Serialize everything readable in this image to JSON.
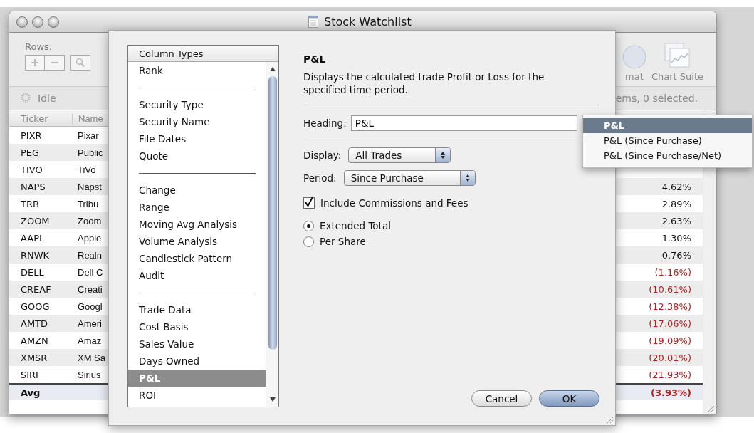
{
  "window": {
    "title": "Stock Watchlist"
  },
  "toolbar": {
    "rows_label": "Rows:",
    "items": [
      {
        "label": "mat"
      },
      {
        "label": "Chart Suite"
      }
    ]
  },
  "status_bar": {
    "state": "Idle",
    "summary": "ems, 0 selected."
  },
  "table": {
    "columns": [
      "Ticker",
      "Name"
    ],
    "rows": [
      {
        "ticker": "PIXR",
        "name": "Pixar"
      },
      {
        "ticker": "PEG",
        "name": "Public"
      },
      {
        "ticker": "TIVO",
        "name": "TiVo"
      },
      {
        "ticker": "NAPS",
        "name": "Napst",
        "value": "4.62%",
        "negative": false
      },
      {
        "ticker": "TRB",
        "name": "Tribu",
        "value": "2.89%",
        "negative": false
      },
      {
        "ticker": "ZOOM",
        "name": "Zoom",
        "value": "2.63%",
        "negative": false
      },
      {
        "ticker": "AAPL",
        "name": "Apple",
        "value": "1.30%",
        "negative": false
      },
      {
        "ticker": "RNWK",
        "name": "Realn",
        "value": "0.76%",
        "negative": false
      },
      {
        "ticker": "DELL",
        "name": "Dell C",
        "value": "(1.16%)",
        "negative": true
      },
      {
        "ticker": "CREAF",
        "name": "Creati",
        "value": "(10.61%)",
        "negative": true
      },
      {
        "ticker": "GOOG",
        "name": "Googl",
        "value": "(12.38%)",
        "negative": true
      },
      {
        "ticker": "AMTD",
        "name": "Ameri",
        "value": "(17.06%)",
        "negative": true
      },
      {
        "ticker": "AMZN",
        "name": "Amaz",
        "value": "(19.09%)",
        "negative": true
      },
      {
        "ticker": "XMSR",
        "name": "XM Sa",
        "value": "(20.01%)",
        "negative": true
      },
      {
        "ticker": "SIRI",
        "name": "Sirius",
        "value": "(21.93%)",
        "negative": true
      }
    ],
    "total": {
      "ticker": "Avg",
      "value": "(3.93%)",
      "negative": true
    }
  },
  "sheet": {
    "list": {
      "header": "Column Types",
      "items": [
        {
          "kind": "item",
          "label": "Rank",
          "selected": false
        },
        {
          "kind": "separator"
        },
        {
          "kind": "item",
          "label": "Security Type",
          "selected": false
        },
        {
          "kind": "item",
          "label": "Security Name",
          "selected": false
        },
        {
          "kind": "item",
          "label": "File Dates",
          "selected": false
        },
        {
          "kind": "item",
          "label": "Quote",
          "selected": false
        },
        {
          "kind": "separator"
        },
        {
          "kind": "item",
          "label": "Change",
          "selected": false
        },
        {
          "kind": "item",
          "label": "Range",
          "selected": false
        },
        {
          "kind": "item",
          "label": "Moving Avg Analysis",
          "selected": false
        },
        {
          "kind": "item",
          "label": "Volume Analysis",
          "selected": false
        },
        {
          "kind": "item",
          "label": "Candlestick Pattern",
          "selected": false
        },
        {
          "kind": "item",
          "label": "Audit",
          "selected": false
        },
        {
          "kind": "separator"
        },
        {
          "kind": "item",
          "label": "Trade Data",
          "selected": false
        },
        {
          "kind": "item",
          "label": "Cost Basis",
          "selected": false
        },
        {
          "kind": "item",
          "label": "Sales Value",
          "selected": false
        },
        {
          "kind": "item",
          "label": "Days Owned",
          "selected": false
        },
        {
          "kind": "item",
          "label": "P&L",
          "selected": true
        },
        {
          "kind": "item",
          "label": "ROI",
          "selected": false
        }
      ]
    },
    "title": "P&L",
    "description": "Displays the calculated trade Profit or Loss for the specified time period.",
    "heading": {
      "label": "Heading:",
      "value": "P&L"
    },
    "display": {
      "label": "Display:",
      "value": "All Trades"
    },
    "period": {
      "label": "Period:",
      "value": "Since Purchase"
    },
    "include_commissions": {
      "label": "Include Commissions and Fees",
      "checked": true
    },
    "radios": [
      {
        "label": "Extended Total",
        "selected": true
      },
      {
        "label": "Per Share",
        "selected": false
      }
    ],
    "buttons": [
      {
        "label": "Cancel",
        "default": false
      },
      {
        "label": "OK",
        "default": true
      }
    ]
  },
  "heading_menu": [
    {
      "label": "P&L",
      "selected": true
    },
    {
      "label": "P&L (Since Purchase)",
      "selected": false
    },
    {
      "label": "P&L (Since Purchase/Net)",
      "selected": false
    }
  ]
}
